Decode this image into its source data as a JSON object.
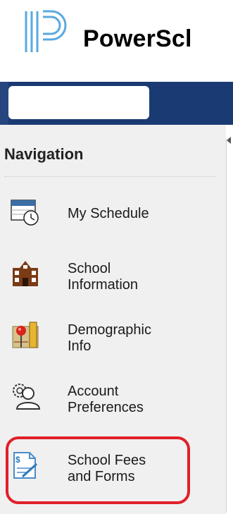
{
  "brand": {
    "name": "PowerScl"
  },
  "navigation": {
    "title": "Navigation",
    "items": [
      {
        "label": "My Schedule",
        "icon": "calendar-clock-icon"
      },
      {
        "label": "School\nInformation",
        "icon": "school-building-icon"
      },
      {
        "label": "Demographic\nInfo",
        "icon": "map-pin-icon"
      },
      {
        "label": "Account\nPreferences",
        "icon": "user-gear-icon"
      },
      {
        "label": "School Fees\nand Forms",
        "icon": "fees-form-icon"
      }
    ]
  },
  "colors": {
    "header_bar": "#1a3a73",
    "highlight": "#e0202a"
  }
}
